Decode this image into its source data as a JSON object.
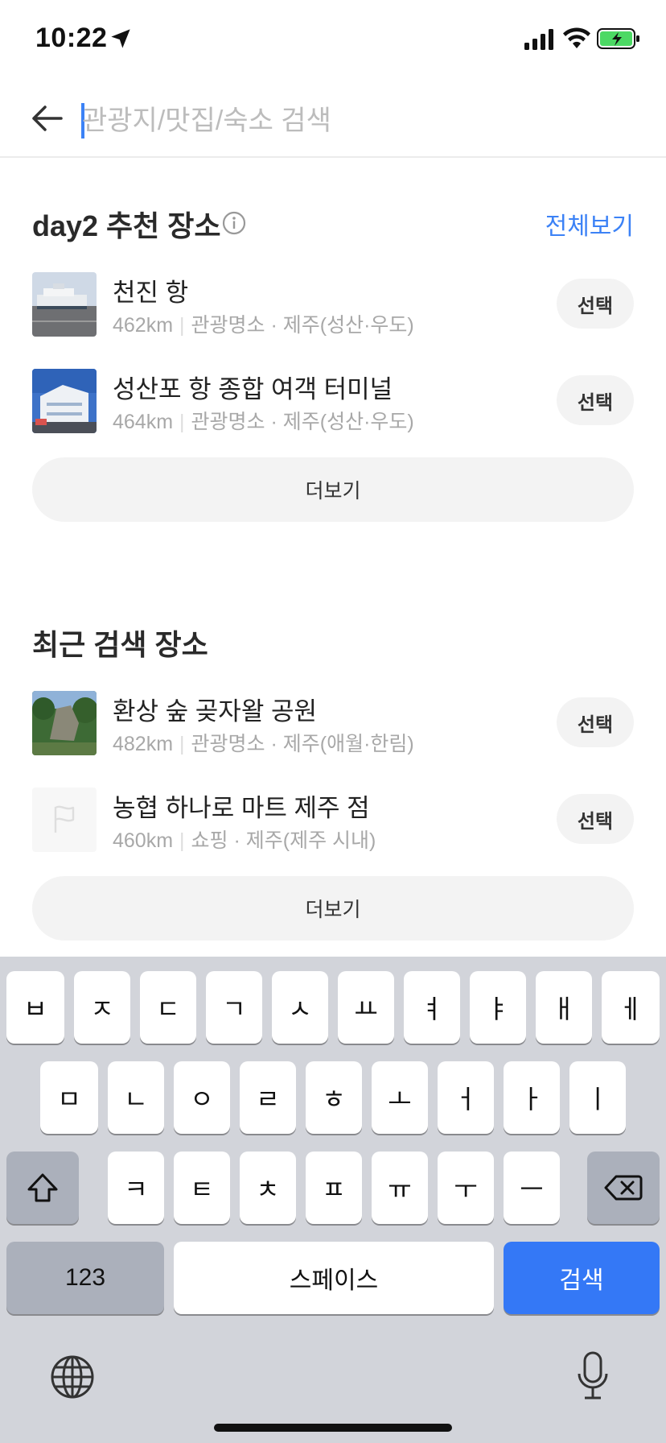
{
  "status": {
    "time": "10:22"
  },
  "search": {
    "placeholder": "관광지/맛집/숙소 검색"
  },
  "recommended": {
    "title": "day2 추천 장소",
    "see_all": "전체보기",
    "items": [
      {
        "name": "천진 항",
        "distance": "462km",
        "category": "관광명소 · 제주(성산·우도)",
        "select": "선택"
      },
      {
        "name": "성산포 항 종합 여객 터미널",
        "distance": "464km",
        "category": "관광명소 · 제주(성산·우도)",
        "select": "선택"
      }
    ],
    "more": "더보기"
  },
  "recent": {
    "title": "최근 검색 장소",
    "items": [
      {
        "name": "환상 숲 곶자왈 공원",
        "distance": "482km",
        "category": "관광명소 · 제주(애월·한림)",
        "select": "선택"
      },
      {
        "name": "농협 하나로 마트 제주 점",
        "distance": "460km",
        "category": "쇼핑 · 제주(제주 시내)",
        "select": "선택"
      }
    ],
    "more": "더보기"
  },
  "keyboard": {
    "row1": [
      "ㅂ",
      "ㅈ",
      "ㄷ",
      "ㄱ",
      "ㅅ",
      "ㅛ",
      "ㅕ",
      "ㅑ",
      "ㅐ",
      "ㅔ"
    ],
    "row2": [
      "ㅁ",
      "ㄴ",
      "ㅇ",
      "ㄹ",
      "ㅎ",
      "ㅗ",
      "ㅓ",
      "ㅏ",
      "ㅣ"
    ],
    "row3": [
      "ㅋ",
      "ㅌ",
      "ㅊ",
      "ㅍ",
      "ㅠ",
      "ㅜ",
      "ㅡ"
    ],
    "numbers": "123",
    "space": "스페이스",
    "search": "검색"
  },
  "colors": {
    "accent": "#3c82f6",
    "keyboard_bg": "#d2d4da",
    "search_key": "#3478f6"
  }
}
